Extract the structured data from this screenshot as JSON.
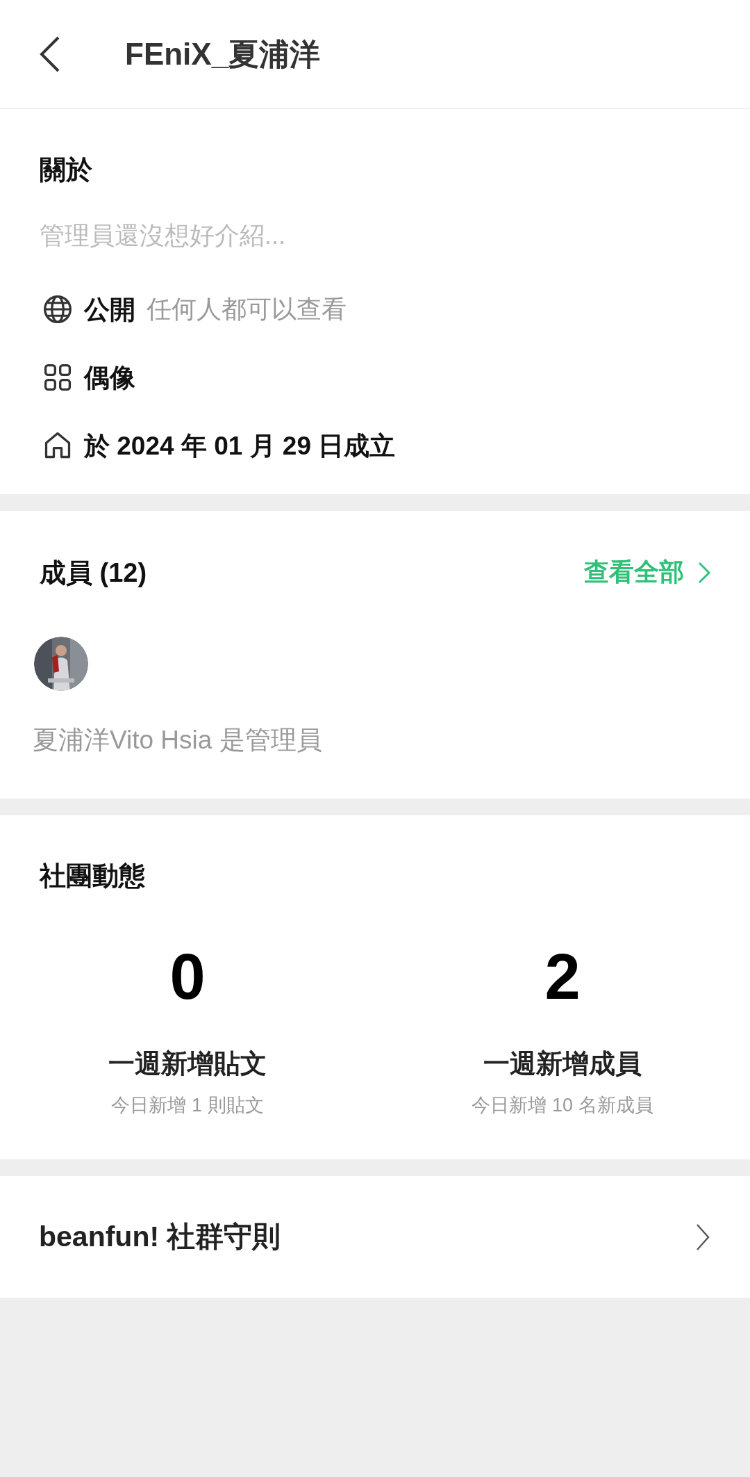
{
  "header": {
    "title": "FEniX_夏浦洋"
  },
  "about": {
    "heading": "關於",
    "description": "管理員還沒想好介紹...",
    "details": [
      {
        "kind": "globe",
        "label": "公開",
        "note": "任何人都可以查看"
      },
      {
        "kind": "grid",
        "label": "偶像"
      },
      {
        "kind": "home",
        "label": "於 2024 年 01 月 29 日成立"
      }
    ]
  },
  "members": {
    "heading": "成員 (12)",
    "view_all": "查看全部",
    "admin_note": "夏浦洋Vito Hsia 是管理員"
  },
  "activity": {
    "heading": "社團動態",
    "stats": [
      {
        "value": "0",
        "label": "一週新增貼文",
        "sub": "今日新增 1 則貼文"
      },
      {
        "value": "2",
        "label": "一週新增成員",
        "sub": "今日新增 10 名新成員"
      }
    ]
  },
  "rules_link": {
    "label": "beanfun! 社群守則"
  }
}
